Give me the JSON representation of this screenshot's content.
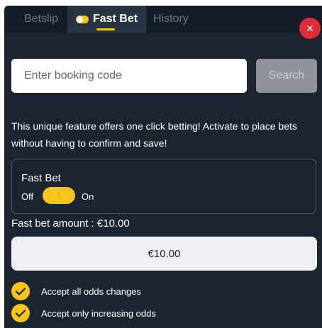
{
  "tabs": [
    {
      "label": "Betslip"
    },
    {
      "label": "Fast Bet",
      "active": true
    },
    {
      "label": "History"
    }
  ],
  "close_icon": "×",
  "booking": {
    "placeholder": "Enter booking code",
    "search_label": "Search"
  },
  "description": "This unique feature offers one click betting! Activate to place bets without having to confirm and save!",
  "fastbet": {
    "title": "Fast Bet",
    "off_label": "Off",
    "on_label": "On",
    "enabled": true
  },
  "amount": {
    "label": "Fast bet amount :  €10.00",
    "value": "€10.00"
  },
  "options": [
    {
      "label": "Accept all odds changes",
      "checked": true
    },
    {
      "label": "Accept only increasing odds",
      "checked": true
    }
  ],
  "colors": {
    "panel_bg": "#1b2430",
    "tabbar_bg": "#141c27",
    "accent_yellow": "#f7c51c",
    "close_red": "#e12b38",
    "search_gray": "#8e9399"
  },
  "icons": {
    "close": "close-icon",
    "check": "check-icon",
    "toggle": "toggle-icon"
  }
}
